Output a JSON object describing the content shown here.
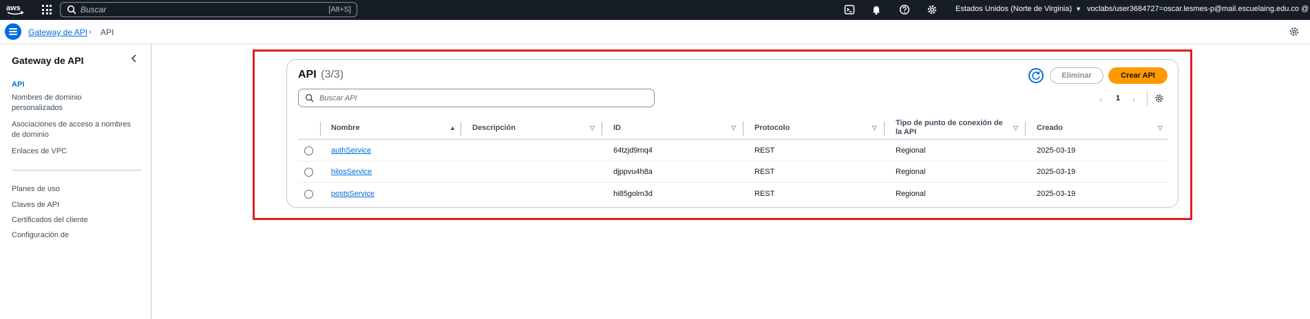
{
  "topbar": {
    "logo": "aws",
    "search_placeholder": "Buscar",
    "search_shortcut": "[Alt+S]",
    "region": "Estados Unidos (Norte de Virginia)",
    "account": "voclabs/user3684727=oscar.lesmes-p@mail.escuelaing.edu.co @ 1..."
  },
  "breadcrumb": {
    "parent": "Gateway de API",
    "current": "API"
  },
  "sidebar": {
    "title": "Gateway de API",
    "items": [
      "API",
      "Nombres de dominio personalizados",
      "Asociaciones de acceso a nombres de dominio",
      "Enlaces de VPC",
      "Planes de uso",
      "Claves de API",
      "Certificados del cliente",
      "Configuración de"
    ]
  },
  "panel": {
    "title": "API",
    "count": "(3/3)",
    "delete_label": "Eliminar",
    "create_label": "Crear API",
    "search_placeholder": "Buscar API",
    "page": "1",
    "columns": [
      "Nombre",
      "Descripción",
      "ID",
      "Protocolo",
      "Tipo de punto de conexión de la API",
      "Creado"
    ],
    "rows": [
      {
        "name": "authService",
        "description": "",
        "id": "64tzjd9mq4",
        "protocol": "REST",
        "endpoint": "Regional",
        "created": "2025-03-19"
      },
      {
        "name": "hilosService",
        "description": "",
        "id": "djppvu4h8a",
        "protocol": "REST",
        "endpoint": "Regional",
        "created": "2025-03-19"
      },
      {
        "name": "postsService",
        "description": "",
        "id": "hi85golm3d",
        "protocol": "REST",
        "endpoint": "Regional",
        "created": "2025-03-19"
      }
    ]
  },
  "colors": {
    "accent": "#006ce0",
    "primary_button": "#ff9900",
    "topbar": "#161d26",
    "highlight": "#e31b23"
  }
}
